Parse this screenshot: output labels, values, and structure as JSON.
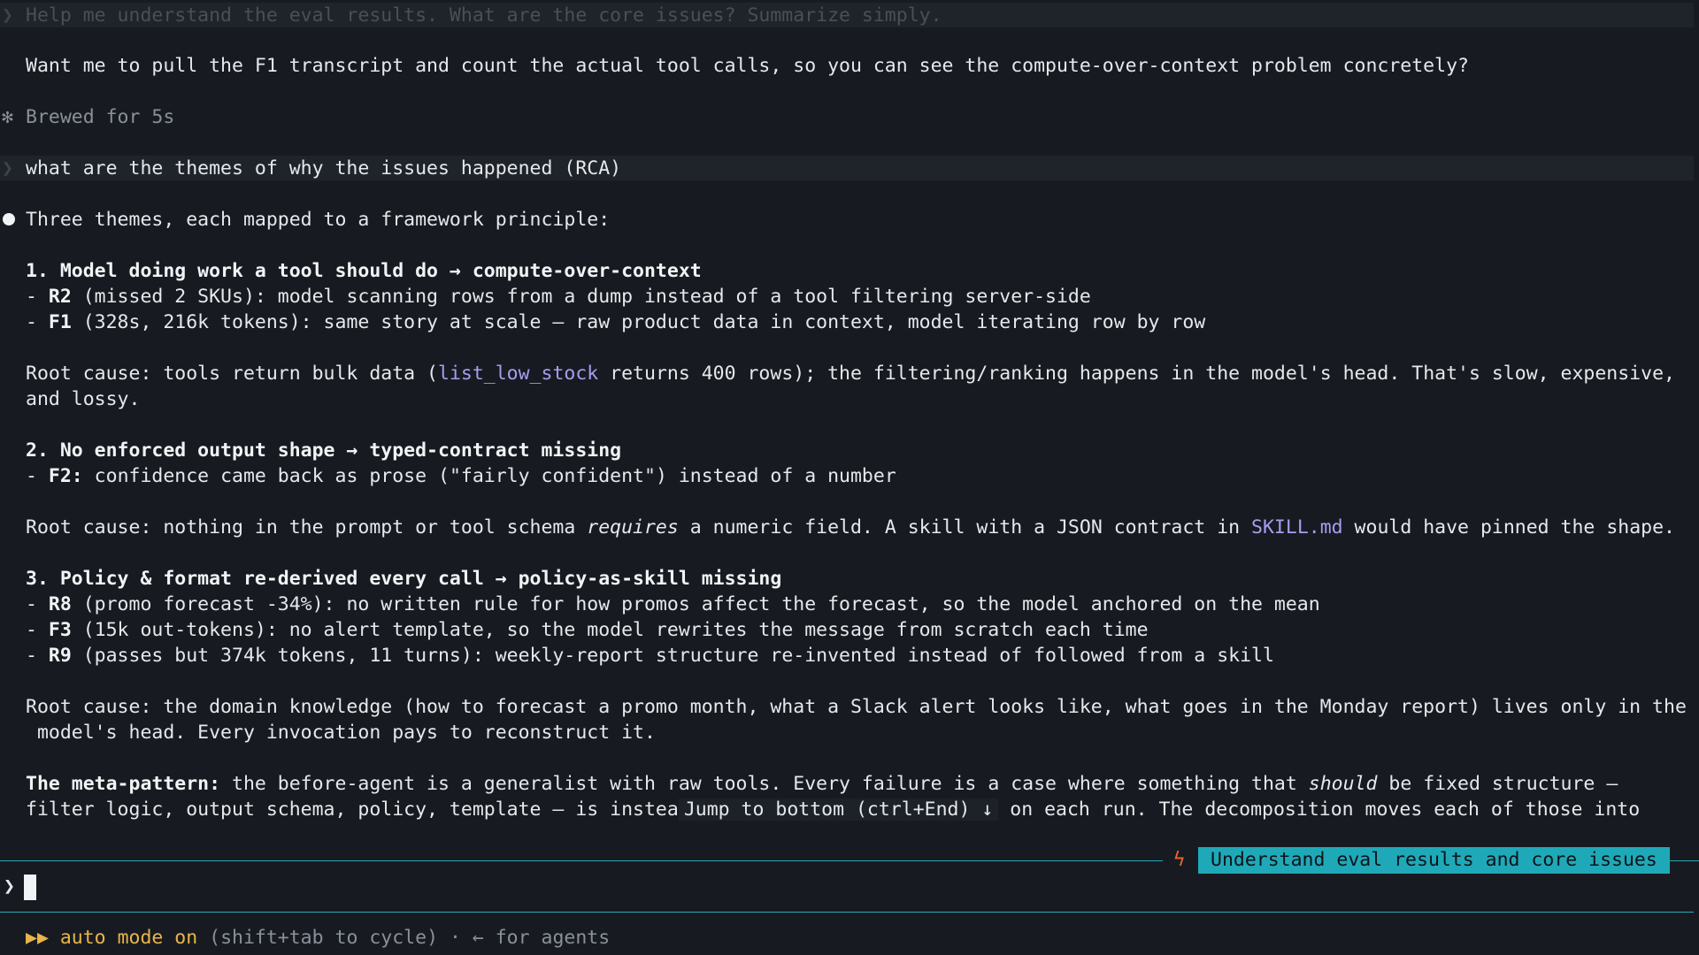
{
  "history_prompt_1": "Help me understand the eval results. What are the core issues? Summarize simply.",
  "offer_text": "Want me to pull the F1 transcript and count the actual tool calls, so you can see the compute-over-context problem concretely?",
  "brewed_text": "Brewed for 5s",
  "user_prompt_2": "what are the themes of why the issues happened (RCA)",
  "response": {
    "intro": "Three themes, each mapped to a framework principle:",
    "theme1_heading": "1. Model doing work a tool should do → compute-over-context",
    "theme1_r2_label": "R2",
    "theme1_r2_text": " (missed 2 SKUs): model scanning rows from a dump instead of a tool filtering server-side",
    "theme1_f1_label": "F1",
    "theme1_f1_text": " (328s, 216k tokens): same story at scale — raw product data in context, model iterating row by row",
    "theme1_root_a": "Root cause: tools return bulk data (",
    "theme1_root_link": "list_low_stock",
    "theme1_root_b": " returns 400 rows); the filtering/ranking happens in the model's head. That's slow, expensive,",
    "theme1_root_c": "and lossy.",
    "theme2_heading": "2. No enforced output shape → typed-contract missing",
    "theme2_f2_label": "F2:",
    "theme2_f2_text": " confidence came back as prose (\"fairly confident\") instead of a number",
    "theme2_root_a": "Root cause: nothing in the prompt or tool schema ",
    "theme2_root_em": "requires",
    "theme2_root_b": " a numeric field. A skill with a JSON contract in ",
    "theme2_root_link": "SKILL.md",
    "theme2_root_c": " would have pinned the shape.",
    "theme3_heading": "3. Policy & format re-derived every call → policy-as-skill missing",
    "theme3_r8_label": "R8",
    "theme3_r8_text": " (promo forecast -34%): no written rule for how promos affect the forecast, so the model anchored on the mean",
    "theme3_f3_label": "F3",
    "theme3_f3_text": " (15k out-tokens): no alert template, so the model rewrites the message from scratch each time",
    "theme3_r9_label": "R9",
    "theme3_r9_text": " (passes but 374k tokens, 11 turns): weekly-report structure re-invented instead of followed from a skill",
    "theme3_root_a": "Root cause: the domain knowledge (how to forecast a promo month, what a Slack alert looks like, what goes in the Monday report) lives only in the",
    "theme3_root_b": " model's head. Every invocation pays to reconstruct it.",
    "meta_label": "The meta-pattern:",
    "meta_a": " the before-agent is a generalist with raw tools. Every failure is a case where something that ",
    "meta_em": "should",
    "meta_b": " be fixed structure —",
    "meta_c": "filter logic, output schema, policy, template — is instea",
    "meta_d": " on each run. The decomposition moves each of those into"
  },
  "jump_to_bottom": "Jump to bottom (ctrl+End) ↓",
  "session_title": "Understand eval results and core issues",
  "input_prompt_symbol": "❯",
  "status": {
    "arrows": "▶▶",
    "mode": "auto mode on",
    "hint": " (shift+tab to cycle) · ← for agents"
  },
  "colors": {
    "background": "#171b21",
    "accent_teal": "#1fa9b8",
    "link_purple": "#a99cf0",
    "mode_yellow": "#e9b54a",
    "bolt_orange": "#e8632f"
  }
}
